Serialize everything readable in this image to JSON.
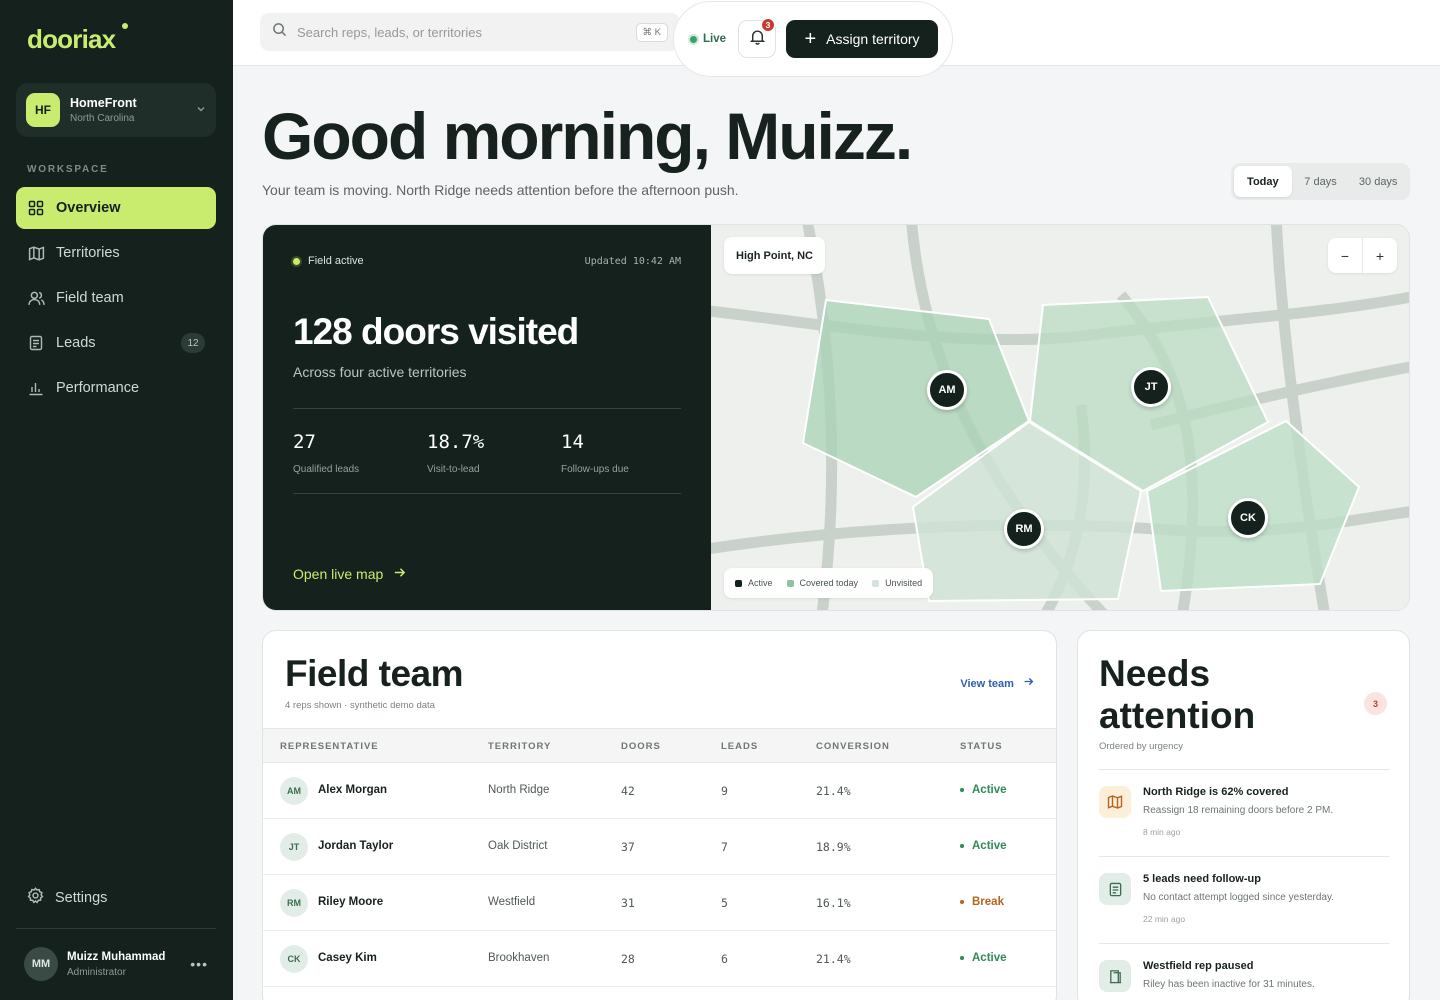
{
  "brand": {
    "logo": "dooriax"
  },
  "org": {
    "initials": "HF",
    "name": "HomeFront",
    "region": "North Carolina"
  },
  "sidebar": {
    "section_label": "WORKSPACE",
    "items": [
      {
        "label": "Overview",
        "icon": "grid-icon"
      },
      {
        "label": "Territories",
        "icon": "map-icon"
      },
      {
        "label": "Field team",
        "icon": "users-icon"
      },
      {
        "label": "Leads",
        "icon": "file-icon",
        "badge": "12"
      },
      {
        "label": "Performance",
        "icon": "bar-chart-icon"
      }
    ],
    "settings_label": "Settings"
  },
  "user": {
    "initials": "MM",
    "name": "Muizz Muhammad",
    "role": "Administrator",
    "more": "•••"
  },
  "topbar": {
    "search_placeholder": "Search reps, leads, or territories",
    "shortcut": "⌘ K",
    "live_label": "Live",
    "notifications": "3",
    "assign_label": "Assign territory"
  },
  "greeting": {
    "title": "Good morning, Muizz.",
    "subtitle": "Your team is moving. North Ridge needs attention before the afternoon push."
  },
  "range": {
    "options": [
      "Today",
      "7 days",
      "30 days"
    ],
    "selected": "Today"
  },
  "hero": {
    "status": "Field active",
    "updated": "Updated 10:42 AM",
    "headline": "128 doors visited",
    "subline": "Across four active territories",
    "stats": [
      {
        "value": "27",
        "label": "Qualified leads"
      },
      {
        "value": "18.7%",
        "label": "Visit-to-lead"
      },
      {
        "value": "14",
        "label": "Follow-ups due"
      }
    ],
    "cta": "Open live map"
  },
  "map": {
    "location": "High Point, NC",
    "zoom_out": "−",
    "zoom_in": "+",
    "legend": [
      {
        "label": "Active",
        "color": "#14211d"
      },
      {
        "label": "Covered today",
        "color": "#8fc4a2"
      },
      {
        "label": "Unvisited",
        "color": "#d6e2da"
      }
    ],
    "pins": [
      "AM",
      "JT",
      "RM",
      "CK"
    ]
  },
  "team": {
    "title": "Field team",
    "subtitle": "4 reps shown · synthetic demo data",
    "view_label": "View team",
    "columns": [
      "REPRESENTATIVE",
      "TERRITORY",
      "DOORS",
      "LEADS",
      "CONVERSION",
      "STATUS"
    ],
    "rows": [
      {
        "initials": "AM",
        "name": "Alex Morgan",
        "territory": "North Ridge",
        "doors": "42",
        "leads": "9",
        "conversion": "21.4%",
        "status": "Active"
      },
      {
        "initials": "JT",
        "name": "Jordan Taylor",
        "territory": "Oak District",
        "doors": "37",
        "leads": "7",
        "conversion": "18.9%",
        "status": "Active"
      },
      {
        "initials": "RM",
        "name": "Riley Moore",
        "territory": "Westfield",
        "doors": "31",
        "leads": "5",
        "conversion": "16.1%",
        "status": "Break"
      },
      {
        "initials": "CK",
        "name": "Casey Kim",
        "territory": "Brookhaven",
        "doors": "28",
        "leads": "6",
        "conversion": "21.4%",
        "status": "Active"
      }
    ]
  },
  "needs": {
    "title": "Needs attention",
    "count": "3",
    "subtitle": "Ordered by urgency",
    "items": [
      {
        "icon": "map-icon",
        "title": "North Ridge is 62% covered",
        "desc": "Reassign 18 remaining doors before 2 PM.",
        "time": "8 min ago"
      },
      {
        "icon": "file-icon",
        "title": "5 leads need follow-up",
        "desc": "No contact attempt logged since yesterday.",
        "time": "22 min ago"
      },
      {
        "icon": "door-icon",
        "title": "Westfield rep paused",
        "desc": "Riley has been inactive for 31 minutes.",
        "time": ""
      }
    ]
  },
  "colors": {
    "sidebar": "#14211d",
    "accent": "#c9ec6f",
    "active": "#2f8a55",
    "break": "#b5651d",
    "alert": "#c93a2e"
  }
}
